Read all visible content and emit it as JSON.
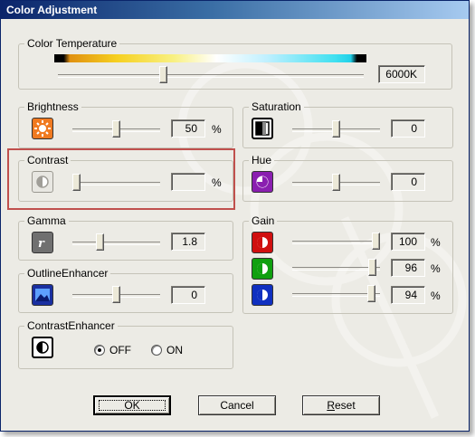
{
  "window": {
    "title": "Color Adjustment"
  },
  "color_temperature": {
    "label": "Color Temperature",
    "value": "6000K",
    "level": 0.34
  },
  "brightness": {
    "label": "Brightness",
    "value": "50",
    "unit": "%",
    "level": 0.5
  },
  "contrast": {
    "label": "Contrast",
    "value": "",
    "unit": "%",
    "level": 0.0
  },
  "gamma": {
    "label": "Gamma",
    "value": "1.8",
    "level": 0.3
  },
  "outline_enhancer": {
    "label": "OutlineEnhancer",
    "value": "0",
    "level": 0.5
  },
  "contrast_enhancer": {
    "label": "ContrastEnhancer",
    "off_label": "OFF",
    "on_label": "ON",
    "selected": "OFF"
  },
  "saturation": {
    "label": "Saturation",
    "value": "0",
    "level": 0.5
  },
  "hue": {
    "label": "Hue",
    "value": "0",
    "level": 0.5
  },
  "gain": {
    "label": "Gain",
    "red": {
      "value": "100",
      "unit": "%",
      "level": 1.0
    },
    "green": {
      "value": "96",
      "unit": "%",
      "level": 0.96
    },
    "blue": {
      "value": "94",
      "unit": "%",
      "level": 0.94
    }
  },
  "buttons": {
    "ok": "OK",
    "cancel": "Cancel",
    "reset": "Reset"
  },
  "colors": {
    "title_bar": "#0a246a",
    "highlight": "#c0504d",
    "gain_red": "#d01010",
    "gain_green": "#10a010",
    "gain_blue": "#1030c0",
    "hue_purple": "#8a1fb0",
    "brightness_orange": "#f07a20"
  }
}
